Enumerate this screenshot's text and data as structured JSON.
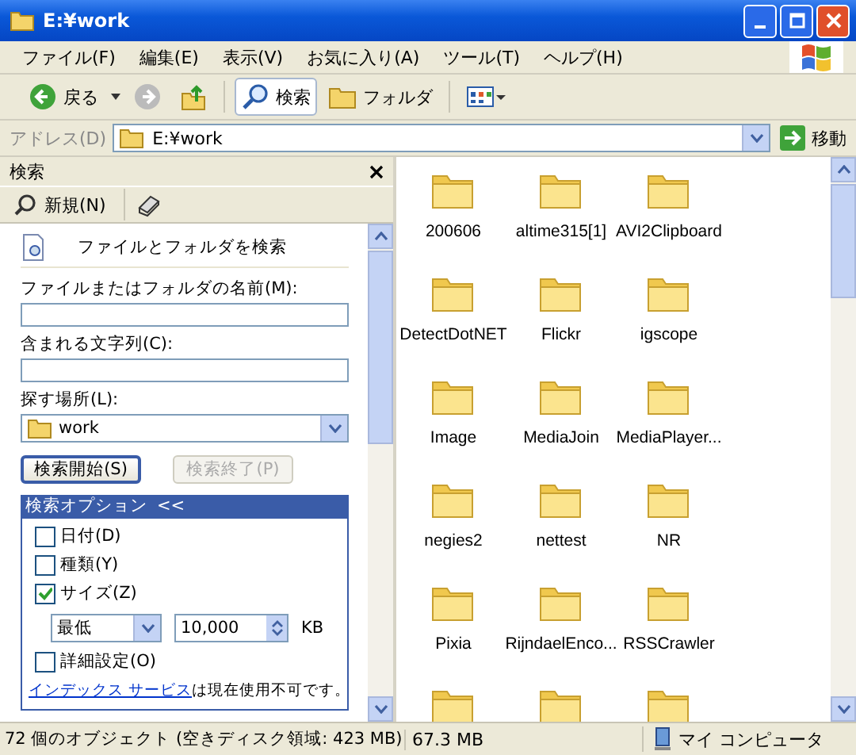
{
  "window": {
    "title": "E:¥work"
  },
  "menu": [
    "ファイル(F)",
    "編集(E)",
    "表示(V)",
    "お気に入り(A)",
    "ツール(T)",
    "ヘルプ(H)"
  ],
  "toolbar": {
    "back": "戻る",
    "search": "検索",
    "folders": "フォルダ"
  },
  "address": {
    "label": "アドレス(D)",
    "value": "E:¥work",
    "go": "移動"
  },
  "search_pane": {
    "title": "検索",
    "new": "新規(N)",
    "heading": "ファイルとフォルダを検索",
    "name_label": "ファイルまたはフォルダの名前(M):",
    "text_label": "含まれる文字列(C):",
    "location_label": "探す場所(L):",
    "location": "work",
    "start": {
      "label": "検索開始(S)",
      "disabled": false
    },
    "stop": {
      "label": "検索終了(P)",
      "disabled": true
    },
    "options_title": "検索オプション",
    "options_toggle": "<<",
    "options": [
      {
        "kind": "checkbox",
        "label": "日付(D)",
        "checked": false
      },
      {
        "kind": "checkbox",
        "label": "種類(Y)",
        "checked": false
      },
      {
        "kind": "checkbox",
        "label": "サイズ(Z)",
        "checked": true
      },
      {
        "kind": "size",
        "mode": "最低",
        "value": "10,000",
        "unit": "KB"
      },
      {
        "kind": "checkbox",
        "label": "詳細設定(O)",
        "checked": false
      },
      {
        "kind": "note",
        "link": "インデックス サービス",
        "text": "は現在使用不可です。"
      }
    ]
  },
  "files": [
    {
      "name": "200606"
    },
    {
      "name": "altime315[1]"
    },
    {
      "name": "AVI2Clipboard"
    },
    {
      "name": "DetectDotNET"
    },
    {
      "name": "Flickr"
    },
    {
      "name": "igscope"
    },
    {
      "name": "Image"
    },
    {
      "name": "MediaJoin"
    },
    {
      "name": "MediaPlayer..."
    },
    {
      "name": "negies2"
    },
    {
      "name": "nettest"
    },
    {
      "name": "NR"
    },
    {
      "name": "Pixia"
    },
    {
      "name": "RijndaelEnco..."
    },
    {
      "name": "RSSCrawler"
    }
  ],
  "files_row_cut_off": true,
  "status": {
    "objects": "72 個のオブジェクト (空きディスク領域: 423 MB)",
    "size": "67.3 MB",
    "location": "マイ コンピュータ"
  }
}
